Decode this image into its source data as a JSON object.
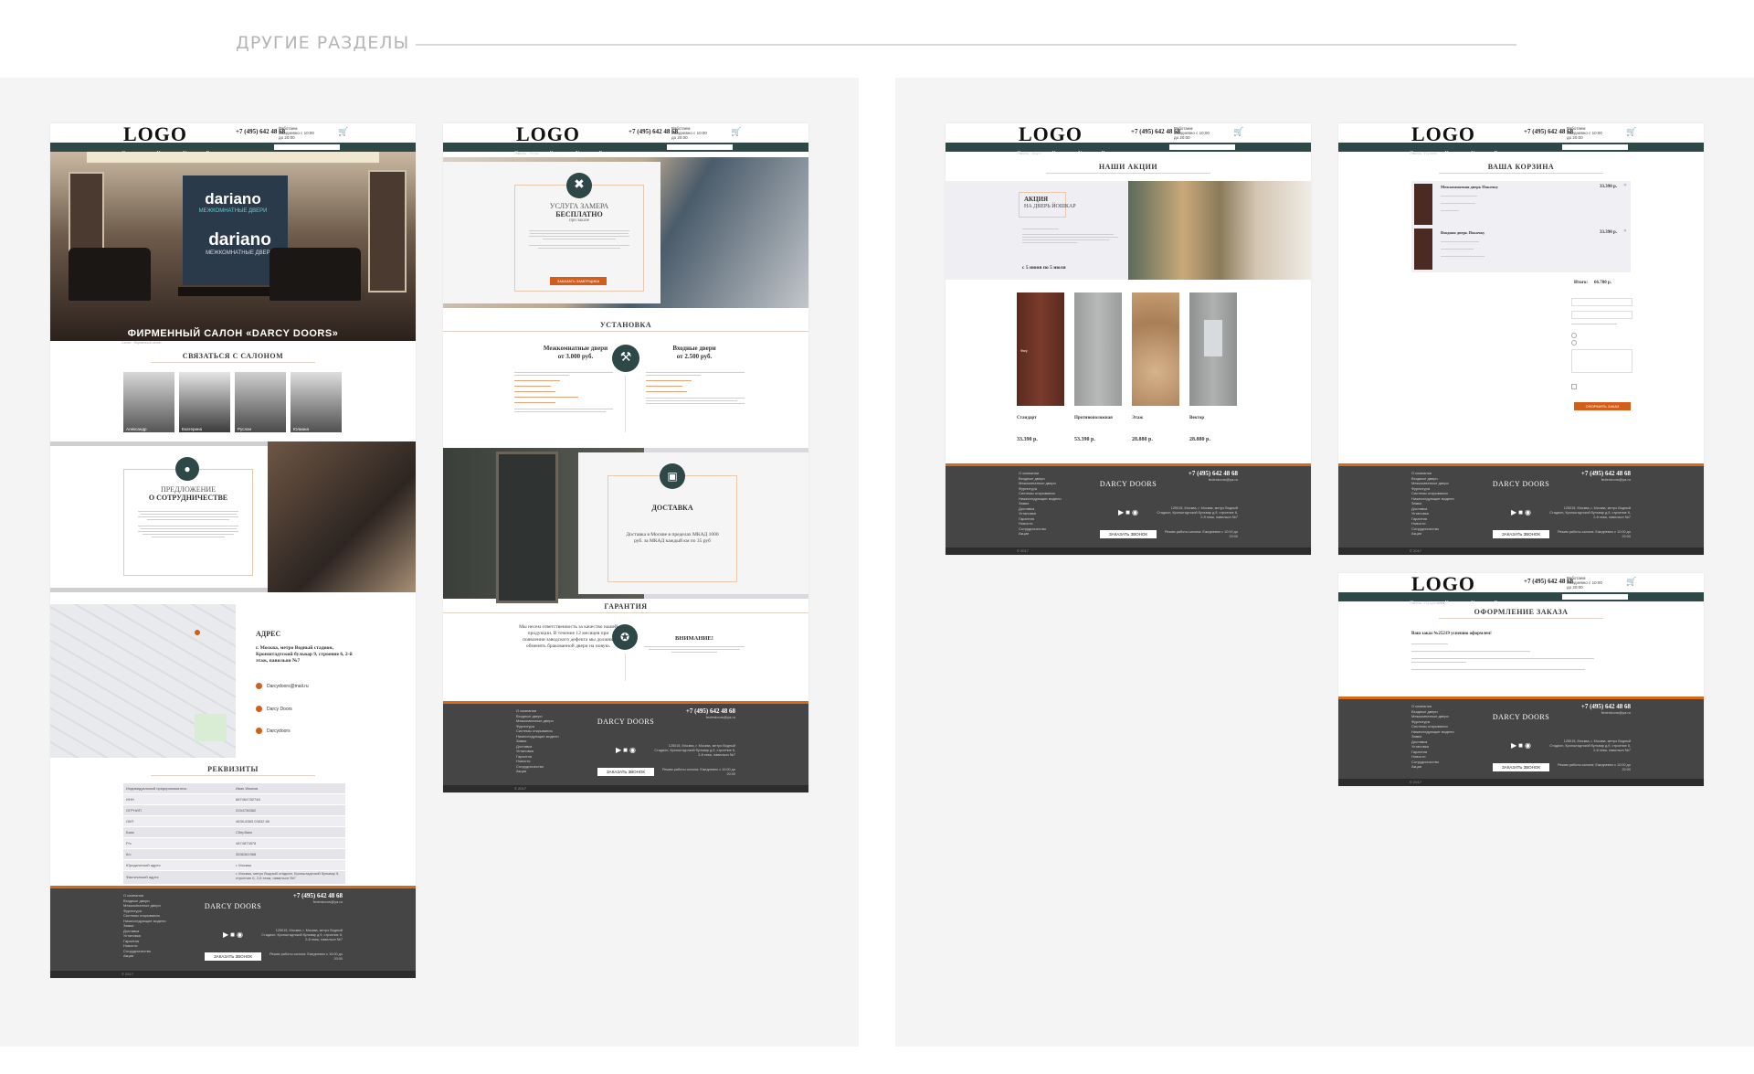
{
  "section_title": "ДРУГИЕ РАЗДЕЛЫ",
  "common": {
    "logo": "LOGO",
    "phone": "+7 (495) 642 48 68",
    "hours": "Работаем ежедневно с 10:00 до 20:00",
    "nav": [
      "О компании",
      "Каталог",
      "Услуги",
      "Где купить"
    ],
    "footer_brand": "DARCY DOORS",
    "footer_phone": "+7 (495) 642 48 68",
    "footer_mail": "federdoors@ya.ru",
    "footer_callback": "ЗАКАЗАТЬ ЗВОНОК",
    "footer_copy": "© 2017",
    "footer_menu": [
      "О компании",
      "Входные двери",
      "Межкомнатные двери",
      "Фурнитура",
      "Системы открывания",
      "Нижеследующие модели",
      "Замки",
      "Доставка",
      "Установка",
      "Гарантия",
      "Новости",
      "Сотрудничество",
      "Акции"
    ],
    "footer_addr": "125015, Москва, г. Москва, метро Водный Стадион, Кронштадтский бульвар д.9, строение 6, 2-й этаж, павильон №7",
    "footer_hours": "Режим работы салона: Ежедневно с 10:00 до 20:00"
  },
  "page_salon": {
    "hero_title": "ФИРМЕННЫЙ САЛОН «DARCY DOORS»",
    "sign1": "dariano",
    "sign1_sub": "МЕЖКОМНАТНЫЕ ДВЕРИ",
    "sign2": "dariano",
    "sign2_sub": "МЕЖКОМНАТНЫЕ ДВЕРИ",
    "contact_title": "СВЯЗАТЬСЯ С САЛОНОМ",
    "people": [
      "Александр",
      "Екатерина",
      "Руслан",
      "Юлиана"
    ],
    "coop_title_1": "ПРЕДЛОЖЕНИЕ",
    "coop_title_2": "О СОТРУДНИЧЕСТВЕ",
    "address_title": "АДРЕС",
    "address_text": "г. Москва, метро Водный стадион, Кронштадтский бульвар 9, строение 6, 2-й этаж, павильон №7",
    "email": "Darcydoors@mail.ru",
    "social1": "Darcy Doors",
    "social2": "Darcydoors",
    "req_title": "РЕКВИЗИТЫ",
    "req_rows": [
      [
        "Индивидуальный предприниматель",
        "Иван Иванов"
      ],
      [
        "ИНН",
        "887464782748"
      ],
      [
        "ОГРНИП",
        "3154736382"
      ],
      [
        "ОКП",
        "4635-8383 03632 86"
      ],
      [
        "Банк",
        "Сбербанк"
      ],
      [
        "Р/с",
        "4874873878"
      ],
      [
        "К/с",
        "3536361988"
      ],
      [
        "Юридический адрес",
        "г. Москва"
      ],
      [
        "Фактический адрес",
        "г. Москва, метро Водный стадион, Кронштадтский бульвар 9, строение 6, 2-й этаж, павильон №7"
      ]
    ]
  },
  "page_services": {
    "measure_1": "УСЛУГА ЗАМЕРА",
    "measure_2": "БЕСПЛАТНО",
    "measure_3": "при заказе",
    "measure_btn": "ЗАКАЗАТЬ ЗАМЕРЩИКА",
    "install_title": "УСТАНОВКА",
    "install_left_1": "Межкомнатные двери",
    "install_left_2": "от 3.000 руб.",
    "install_right_1": "Входные двери",
    "install_right_2": "от 2.500 руб.",
    "delivery_title": "ДОСТАВКА",
    "delivery_text": "Доставка в Москве в пределах МКАД 1000 руб. за МКАД каждый км по 35 руб",
    "guarantee_title": "ГАРАНТИЯ",
    "guarantee_left": "Мы несем ответственность за качество нашей продукции. В течение 12 месяцев при появлении заводского дефекта мы должны обменять бракованной двери на новую.",
    "guarantee_right_title": "ВНИМАНИЕ!"
  },
  "page_promo": {
    "title": "НАШИ АКЦИИ",
    "promo_1": "АКЦИЯ",
    "promo_2": "НА ДВЕРЬ ЙОШКАР",
    "promo_date": "с 5 июня по 5 июля",
    "doors": [
      {
        "name": "Стандарт",
        "price": "33.390 р."
      },
      {
        "name": "Противоположная",
        "price": "53.390 р."
      },
      {
        "name": "Этаж",
        "price": "28.880 р."
      },
      {
        "name": "Вектор",
        "price": "28.880 р."
      }
    ],
    "door_tag": "Фигу"
  },
  "page_cart": {
    "title": "ВАША КОРЗИНА",
    "items": [
      {
        "name": "Межкомнатная дверь Покочку",
        "price": "33.390 р."
      },
      {
        "name": "Входная дверь Покочку",
        "price": "33.390 р."
      }
    ],
    "total_label": "Итого:",
    "total": "66.780 р.",
    "order_btn": "ОФОРМИТЬ ЗАКАЗ"
  },
  "page_order": {
    "title": "ОФОРМЛЕНИЕ ЗАКАЗА",
    "msg": "Ваш заказ №25219 успешно оформлен!"
  },
  "colors": {
    "nav": "#2e4747",
    "accent": "#d35e1a",
    "footer": "#454545"
  }
}
